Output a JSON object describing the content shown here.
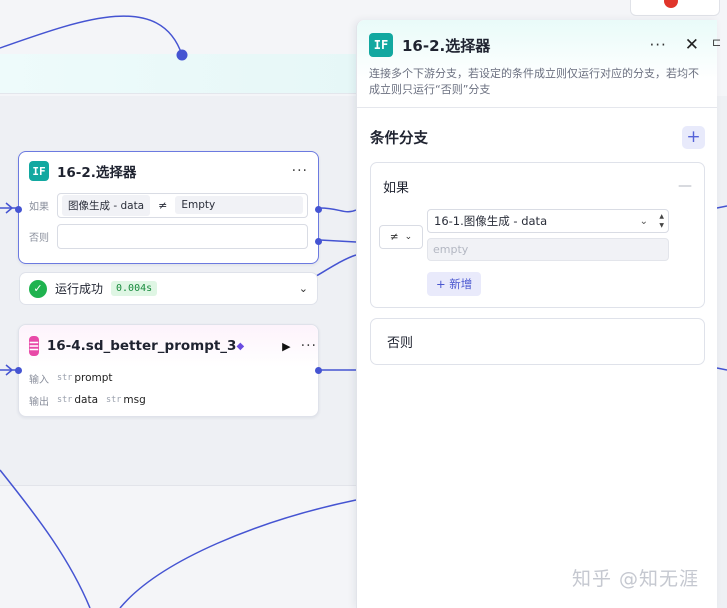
{
  "canvas": {
    "node_if": {
      "icon": "IF",
      "title": "16-2.选择器",
      "more": "···",
      "if_label": "如果",
      "else_label": "否则",
      "cond_var": "图像生成 - data",
      "cond_op": "≠",
      "cond_value": "Empty"
    },
    "status": {
      "label": "运行成功",
      "time": "0.004s"
    },
    "node_prompt": {
      "icon": "☰",
      "title": "16-4.sd_better_prompt_3",
      "more": "···",
      "input_label": "输入",
      "output_label": "输出",
      "inputs": [
        {
          "type": "str",
          "name": "prompt"
        }
      ],
      "outputs": [
        {
          "type": "str",
          "name": "data"
        },
        {
          "type": "str",
          "name": "msg"
        }
      ]
    }
  },
  "panel": {
    "icon": "IF",
    "title": "16-2.选择器",
    "more": "···",
    "close": "✕",
    "description": "连接多个下游分支，若设定的条件成立则仅运行对应的分支，若均不成立则只运行“否则”分支",
    "section_title": "条件分支",
    "add": "+",
    "if_branch": {
      "label": "如果",
      "operator": "≠",
      "variable": "16-1.图像生成 - data",
      "value_placeholder": "empty",
      "new_button": "+ 新增"
    },
    "else_branch": {
      "label": "否则"
    }
  },
  "watermark": "知乎 @知无涯",
  "colors": {
    "accent": "#4554d2",
    "if_icon": "#12a8a0",
    "prompt_icon": "#e84aa8",
    "success": "#1fb34f"
  }
}
